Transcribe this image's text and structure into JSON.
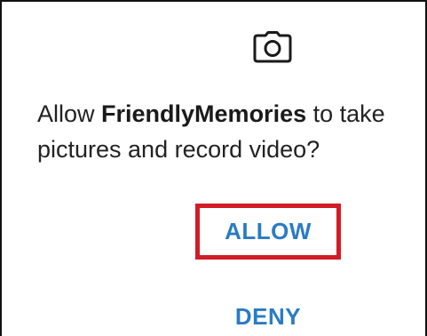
{
  "dialog": {
    "icon": "camera-icon",
    "message_prefix": "Allow ",
    "app_name": "FriendlyMemories",
    "message_suffix": " to take pictures and record video?",
    "allow_label": "ALLOW",
    "deny_label": "DENY"
  },
  "colors": {
    "accent": "#2b7bc4",
    "highlight_border": "#d11c25",
    "text": "#222222"
  }
}
